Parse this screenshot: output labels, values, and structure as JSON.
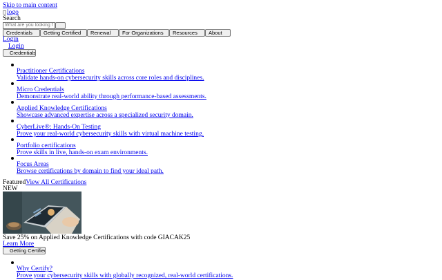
{
  "skip_link": "Skip to main content",
  "logo_alt": "logo",
  "search": {
    "label": "Search",
    "placeholder": "What are you looking f"
  },
  "nav": [
    "Credentials",
    "Getting Certified",
    "Renewal",
    "For Organizations",
    "Resources",
    "About"
  ],
  "login_links": [
    "Login",
    "Login"
  ],
  "credentials_button": "Credentials",
  "credential_items": [
    {
      "title": "Practitioner Certifications",
      "desc": "Validate hands-on cybersecurity skills across core roles and disciplines."
    },
    {
      "title": "Micro Credentials",
      "desc": "Demonstrate real-world ability through performance-based assessments."
    },
    {
      "title": "Applied Knowledge Certifications",
      "desc": "Showcase advanced expertise across a specialized security domain."
    },
    {
      "title": "CyberLive®: Hands-On Testing",
      "desc": "Prove your real-world cybersecurity skills with virtual machine testing."
    },
    {
      "title": "Portfolio certifications",
      "desc": "Prove skills in live, hands-on exam environments."
    },
    {
      "title": "Focus Areas",
      "desc": "Browse certifications by domain to find your ideal path."
    }
  ],
  "featured": {
    "label": "Featured",
    "view_all": "View All Certifications",
    "badge": "NEW",
    "promo_text": "Save 25% on Applied Knowledge Certifications with code GIACAK25",
    "learn_more": "Learn More"
  },
  "getting_certified_button": "Getting Certified",
  "getting_certified_items": [
    {
      "title": "Why Certify?",
      "desc": "Prove your cybersecurity skills with globally recognized, real-world certifications."
    }
  ],
  "colors": {
    "link": "#0000ee",
    "button_bg": "#efefef",
    "button_border": "#767676"
  }
}
